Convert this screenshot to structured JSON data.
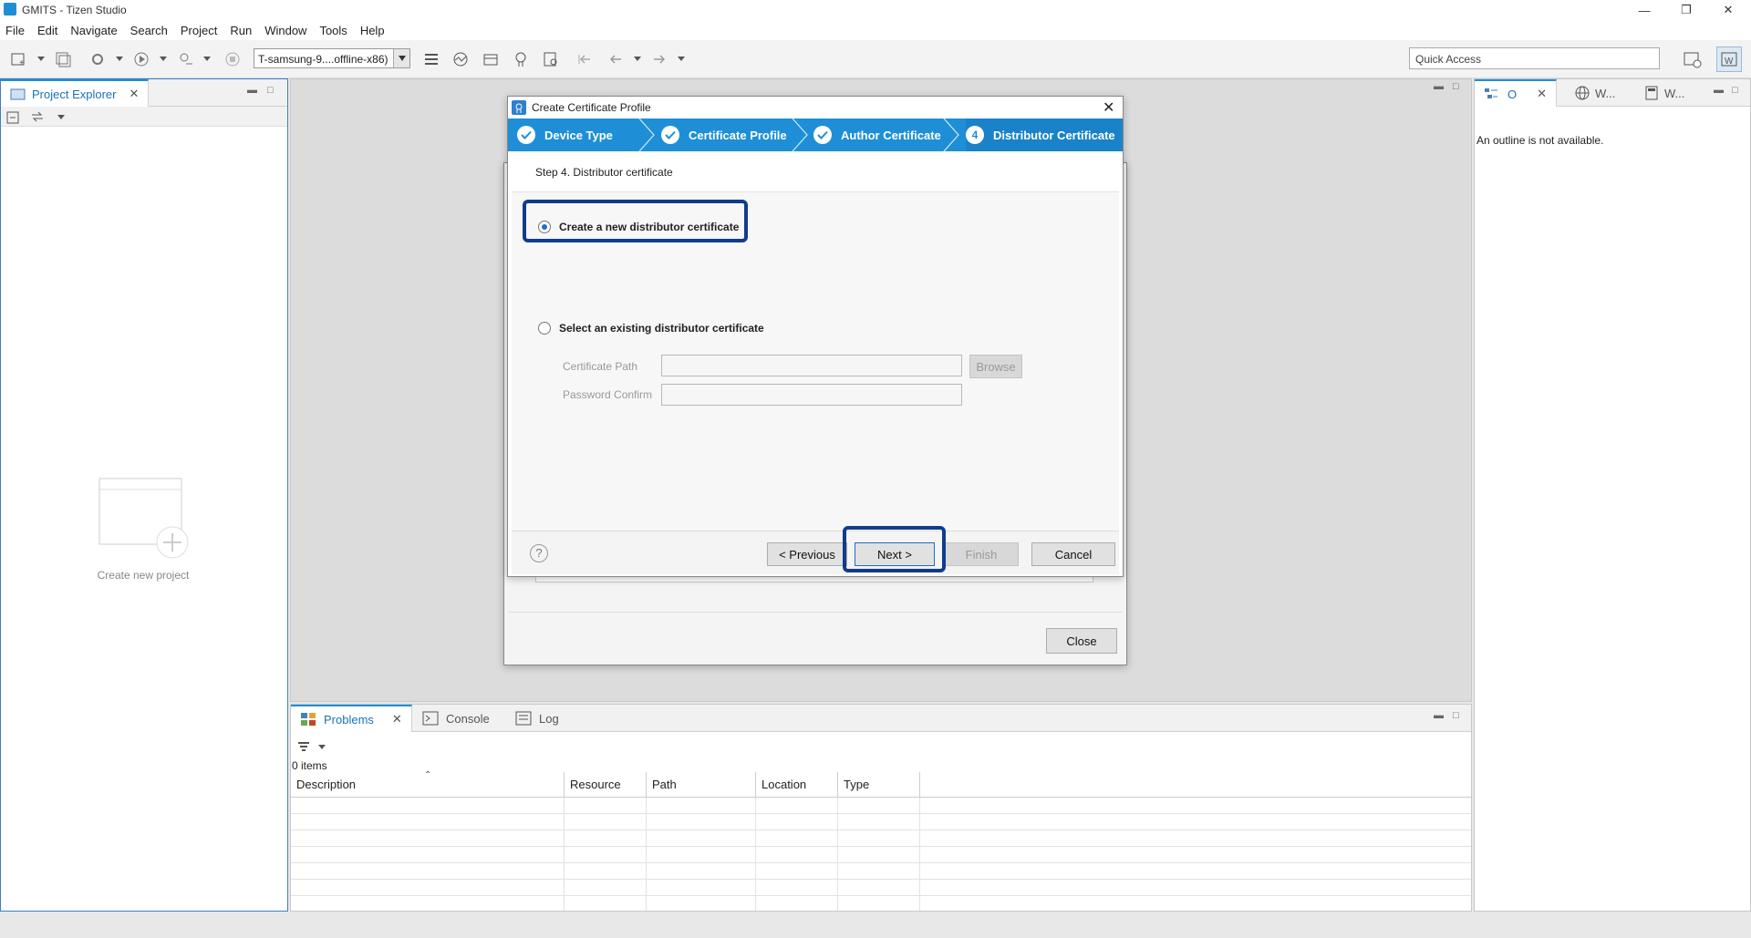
{
  "window": {
    "title": "GMITS - Tizen Studio"
  },
  "menu": [
    "File",
    "Edit",
    "Navigate",
    "Search",
    "Project",
    "Run",
    "Window",
    "Tools",
    "Help"
  ],
  "toolbar": {
    "device_target": "T-samsung-9....offline-x86)",
    "quick_access_placeholder": "Quick Access"
  },
  "project_explorer": {
    "tab_label": "Project Explorer",
    "empty_label": "Create new project"
  },
  "outline": {
    "tab_o": "O",
    "tab_w1": "W...",
    "tab_w2": "W...",
    "message": "An outline is not available."
  },
  "bottom_panel": {
    "tabs": [
      "Problems",
      "Console",
      "Log"
    ],
    "items_count": "0 items",
    "columns": [
      "Description",
      "Resource",
      "Path",
      "Location",
      "Type"
    ]
  },
  "dialog": {
    "title": "Create Certificate Profile",
    "steps": [
      "Device Type",
      "Certificate Profile",
      "Author Certificate",
      "Distributor Certificate"
    ],
    "active_step_number": "4",
    "step_heading": "Step 4. Distributor certificate",
    "option_new": "Create a new distributor certificate",
    "option_existing": "Select an existing distributor certificate",
    "cert_path_label": "Certificate Path",
    "password_confirm_label": "Password Confirm",
    "browse_label": "Browse",
    "help_glyph": "?",
    "buttons": {
      "previous": "< Previous",
      "next": "Next >",
      "finish": "Finish",
      "cancel": "Cancel"
    }
  },
  "background_dialog": {
    "close_label": "Close"
  },
  "colors": {
    "accent": "#1e8fd6",
    "step_bar": "#1e8fd6",
    "highlight": "#0f3d8c"
  }
}
